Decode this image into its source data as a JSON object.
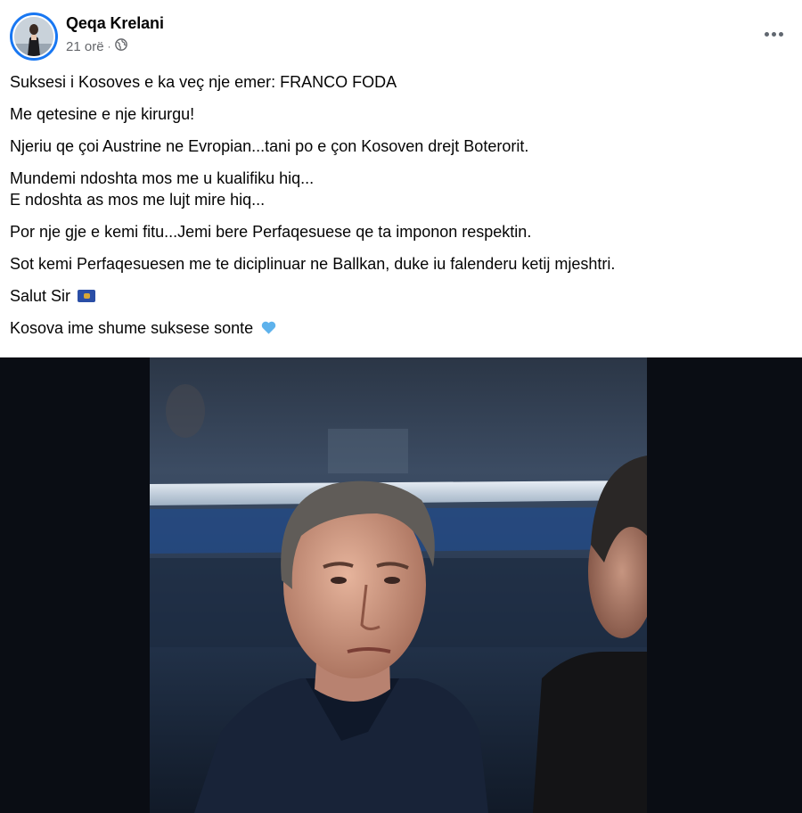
{
  "post": {
    "author": "Qeqa Krelani",
    "time": "21 orë",
    "audience_icon": "globe-icon",
    "more_icon": "more-options-icon",
    "paragraphs": [
      "Suksesi i Kosoves e ka veç nje emer: FRANCO FODA",
      "Me qetesine e nje kirurgu!",
      "Njeriu qe çoi Austrine ne Evropian...tani po e çon Kosoven drejt Boterorit.",
      "Mundemi ndoshta mos me u kualifiku hiq...",
      "E ndoshta as mos me lujt mire hiq...",
      "Por nje gje e kemi fitu...Jemi bere Perfaqesuese qe ta imponon respektin.",
      "Sot kemi Perfaqesuesen me te diciplinuar ne Ballkan, duke iu falenderu ketij mjeshtri.",
      "Salut Sir",
      "Kosova ime shume suksese sonte"
    ],
    "flag_emoji": "kosovo-flag-icon",
    "heart_emoji": "blue-heart-icon",
    "colors": {
      "accent": "#1877f2",
      "text": "#050505",
      "secondary": "#65676b",
      "photo_bg": "#0a0d14"
    }
  }
}
